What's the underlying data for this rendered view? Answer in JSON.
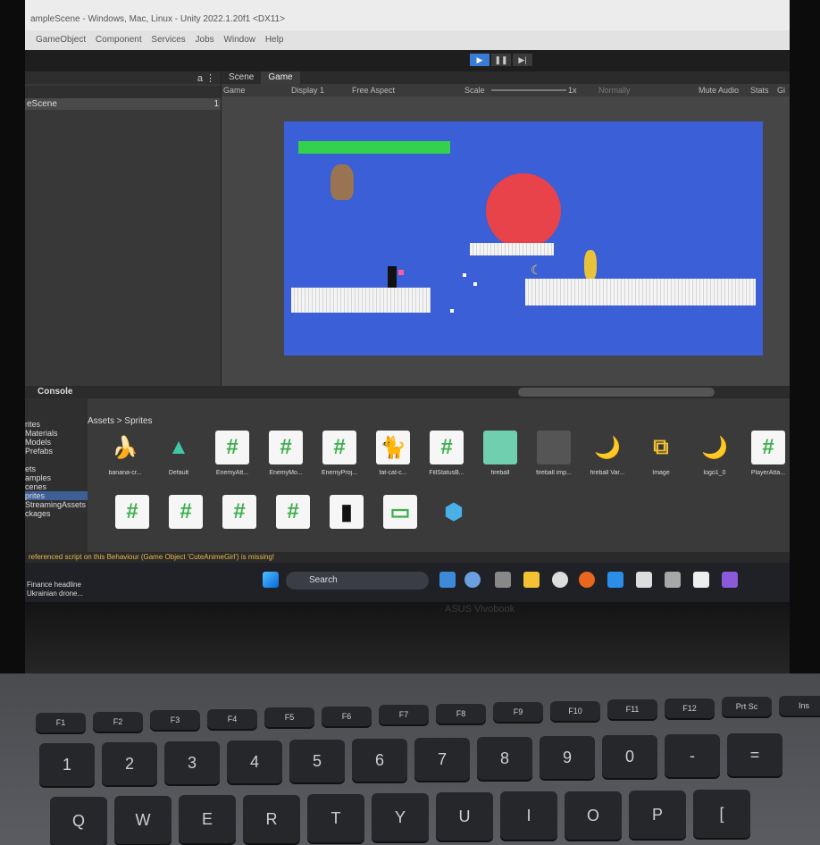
{
  "window_title": "ampleScene - Windows, Mac, Linux - Unity 2022.1.20f1 <DX11>",
  "menu": [
    "GameObject",
    "Component",
    "Services",
    "Jobs",
    "Window",
    "Help"
  ],
  "toolbar": {
    "play_icon": "play-icon",
    "pause_icon": "pause-icon",
    "step_icon": "step-icon",
    "play_glyph": "▶",
    "pause_glyph": "❚❚",
    "step_glyph": "▶|"
  },
  "hierarchy": {
    "head_icons": "a ⋮",
    "scene_name": "eScene",
    "scene_index": "1"
  },
  "game_tabs": [
    "Scene",
    "Game"
  ],
  "game_bar": {
    "view": "Game",
    "display": "Display 1",
    "aspect": "Free Aspect",
    "scale_label": "Scale",
    "scale_value": "1x",
    "mode": "Normally",
    "mute": "Mute Audio",
    "stats": "Stats",
    "gizmos": "Gi"
  },
  "console_tab": "Console",
  "project": {
    "folders": [
      "rites",
      "Materials",
      "Models",
      "Prefabs",
      "",
      "ets",
      "amples",
      "cenes",
      "prites",
      "StreamingAssets",
      "ckages"
    ],
    "selected_folder": 8,
    "breadcrumb": "Assets > Sprites",
    "row1": [
      {
        "label": "banana-cr...",
        "glyph": "🍌"
      },
      {
        "label": "Default",
        "glyph": "▲"
      },
      {
        "label": "EnemyAtt...",
        "glyph": "#"
      },
      {
        "label": "EnemyMo...",
        "glyph": "#"
      },
      {
        "label": "EnemyProj...",
        "glyph": "#"
      },
      {
        "label": "fat-cat-c...",
        "glyph": "🐈"
      },
      {
        "label": "FillStatusB...",
        "glyph": "#"
      },
      {
        "label": "fireball",
        "glyph": ""
      },
      {
        "label": "fireball imp...",
        "glyph": ""
      },
      {
        "label": "fireball Var...",
        "glyph": "🌙"
      },
      {
        "label": "Image",
        "glyph": "⧉"
      },
      {
        "label": "logo1_0",
        "glyph": "🌙"
      },
      {
        "label": "PlayerAtta...",
        "glyph": "#"
      }
    ],
    "row2_glyphs": [
      "#",
      "#",
      "#",
      "#",
      "▮",
      "▭",
      "⬢"
    ]
  },
  "status_message": "referenced script on this Behaviour (Game Object 'CuteAnimeGirl') is missing!",
  "taskbar": {
    "news_line1": "Finance headline",
    "news_line2": "Ukrainian drone...",
    "search_label": "Search"
  },
  "laptop_brand": "ASUS Vivobook",
  "fkeys": [
    "F1",
    "F2",
    "F3",
    "F4",
    "F5",
    "F6",
    "F7",
    "F8",
    "F9",
    "F10",
    "F11",
    "F12",
    "Prt Sc",
    "Ins"
  ],
  "number_keys": [
    "1",
    "2",
    "3",
    "4",
    "5",
    "6",
    "7",
    "8",
    "9",
    "0",
    "-",
    "="
  ],
  "letter_keys": [
    "Q",
    "W",
    "E",
    "R",
    "T",
    "Y",
    "U",
    "I",
    "O",
    "P",
    "["
  ],
  "colors": {
    "accent": "#3a7bd5",
    "game_bg": "#3a5fd6",
    "health": "#33d24a",
    "enemy": "#e8424a"
  }
}
